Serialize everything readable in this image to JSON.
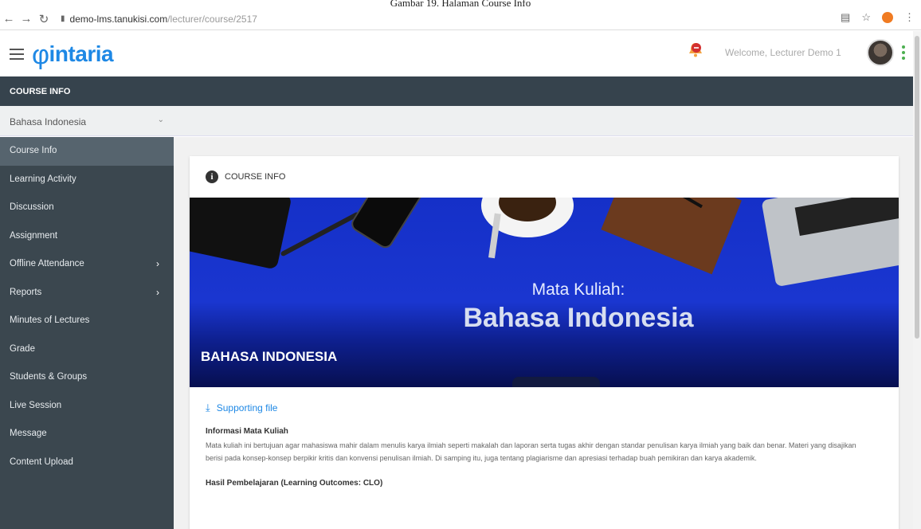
{
  "caption": "Gambar 19. Halaman Course Info",
  "browser": {
    "url_host": "demo-lms.tanukisi.com",
    "url_path": "/lecturer/course/2517"
  },
  "app": {
    "brand": "intaria",
    "welcome": "Welcome, Lecturer Demo 1"
  },
  "topbar": {
    "label": "COURSE INFO"
  },
  "course_select": {
    "value": "Bahasa Indonesia"
  },
  "sidebar": {
    "items": [
      {
        "label": "Course Info"
      },
      {
        "label": "Learning Activity"
      },
      {
        "label": "Discussion"
      },
      {
        "label": "Assignment"
      },
      {
        "label": "Offline Attendance"
      },
      {
        "label": "Reports"
      },
      {
        "label": "Minutes of Lectures"
      },
      {
        "label": "Grade"
      },
      {
        "label": "Students & Groups"
      },
      {
        "label": "Live Session"
      },
      {
        "label": "Message"
      },
      {
        "label": "Content Upload"
      }
    ]
  },
  "card": {
    "heading": "COURSE INFO",
    "banner_sub": "Mata Kuliah:",
    "banner_main": "Bahasa Indonesia",
    "banner_title": "BAHASA INDONESIA",
    "supporting_file": "Supporting file",
    "info_heading": "Informasi Mata Kuliah",
    "info_text": "Mata kuliah ini bertujuan agar mahasiswa mahir dalam menulis karya ilmiah seperti makalah dan laporan serta tugas akhir dengan standar penulisan karya ilmiah yang baik dan benar. Materi yang disajikan berisi pada konsep-konsep berpikir kritis dan konvensi penulisan ilmiah. Di samping itu, juga tentang plagiarisme dan apresiasi terhadap buah pemikiran dan karya akademik.",
    "lo_heading": "Hasil Pembelajaran (Learning Outcomes: CLO)"
  }
}
